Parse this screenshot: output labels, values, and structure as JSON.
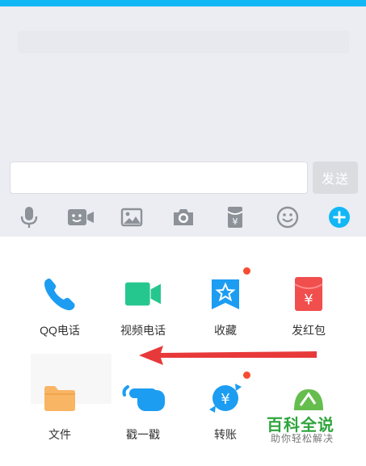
{
  "header": {
    "title": ""
  },
  "composer": {
    "input_value": "",
    "send_label": "发送"
  },
  "toolbar": {
    "items": [
      {
        "icon": "microphone-icon"
      },
      {
        "icon": "video-face-icon"
      },
      {
        "icon": "image-icon"
      },
      {
        "icon": "camera-icon"
      },
      {
        "icon": "red-packet-icon"
      },
      {
        "icon": "emoji-icon"
      },
      {
        "icon": "plus-icon"
      }
    ]
  },
  "panel": {
    "items": [
      {
        "label": "QQ电话",
        "icon": "phone-icon",
        "badge": false
      },
      {
        "label": "视频电话",
        "icon": "video-call-icon",
        "badge": false
      },
      {
        "label": "收藏",
        "icon": "favorites-icon",
        "badge": true
      },
      {
        "label": "发红包",
        "icon": "red-envelope-icon",
        "badge": false
      },
      {
        "label": "文件",
        "icon": "folder-icon",
        "badge": false
      },
      {
        "label": "戳一戳",
        "icon": "poke-hand-icon",
        "badge": false
      },
      {
        "label": "转账",
        "icon": "transfer-icon",
        "badge": true
      },
      {
        "label": "",
        "icon": "partial-green-icon",
        "badge": false
      }
    ]
  },
  "watermark": {
    "title": "百科全说",
    "subtitle": "助你轻松解决"
  },
  "colors": {
    "brand_blue": "#12b7f5",
    "toolbar_gray": "#8d9299",
    "badge_red": "#f74c31",
    "phone_blue": "#1c9df2",
    "video_green": "#26c78e",
    "envelope_red": "#f14e4e",
    "folder_orange": "#f8b564"
  }
}
